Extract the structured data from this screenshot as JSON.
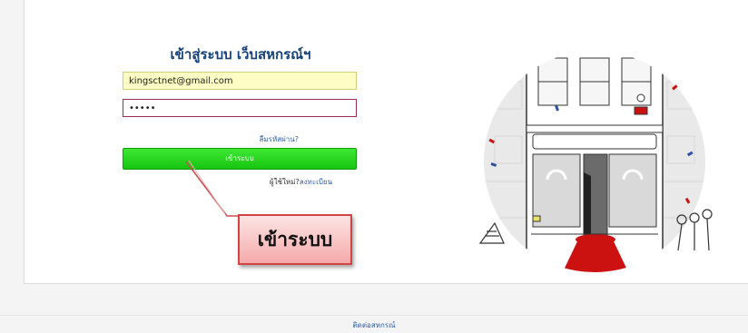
{
  "login": {
    "title": "เข้าสู่ระบบ เว็บสหกรณ์ฯ",
    "email_value": "kingsctnet@gmail.com",
    "password_value": "•••••",
    "forgot_password": "ลืมรหัสผ่าน?",
    "submit_label": "เข้าระบบ",
    "new_user_prefix": "ผู้ใช้ใหม่?",
    "register_link": "ลงทะเบียน"
  },
  "callout": {
    "text": "เข้าระบบ"
  },
  "footer": {
    "contact_link": "ติดต่อสหกรณ์"
  },
  "colors": {
    "title": "#13407a",
    "button": "#17c40e",
    "callout_border": "#d04444",
    "carpet": "#cc1111"
  },
  "illustration": "storefront-with-red-carpet"
}
